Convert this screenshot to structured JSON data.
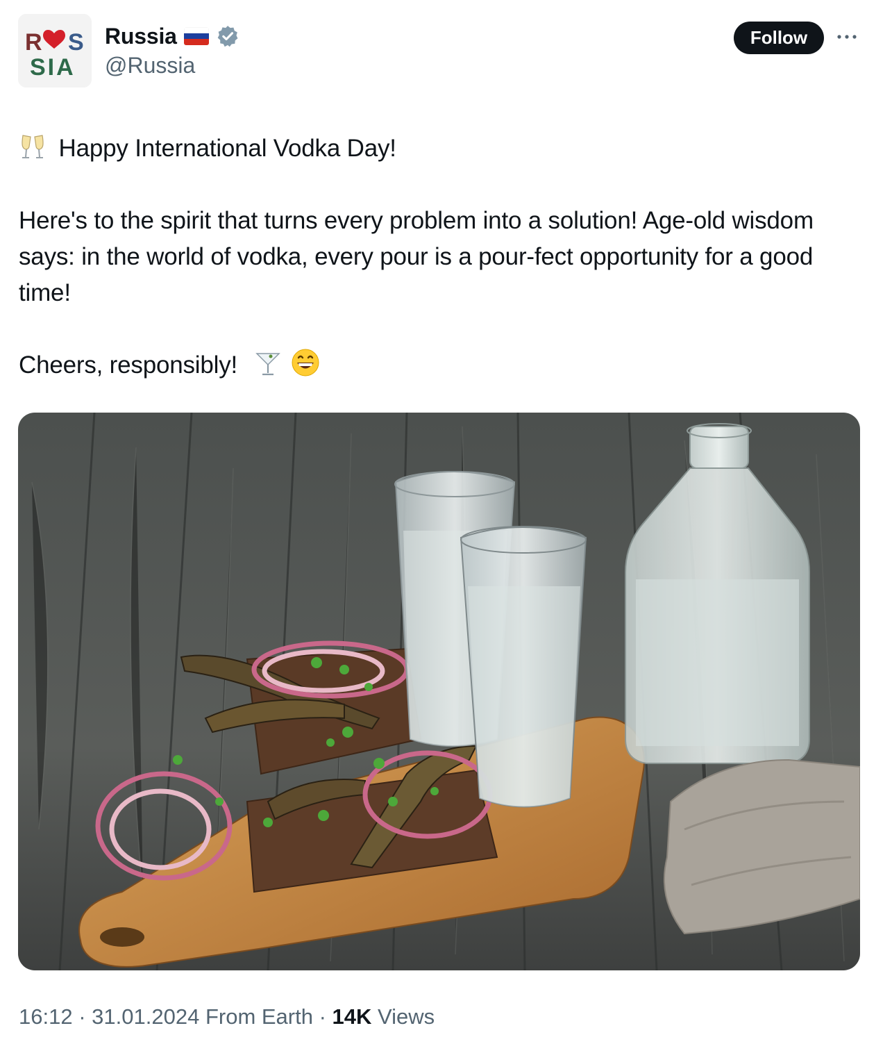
{
  "account": {
    "display_name": "Russia",
    "handle": "@Russia",
    "avatar_text": {
      "line1_left": "R",
      "line1_right": "S",
      "line2": "SIA"
    },
    "flag_icon": "russia-flag-icon",
    "verified_icon": "verified-badge-icon",
    "verified_color": "#829aab"
  },
  "actions": {
    "follow_label": "Follow",
    "more_icon": "more-options-icon"
  },
  "tweet": {
    "line1": "Happy International Vodka Day!",
    "line1_icon": "clinking-glasses-icon",
    "paragraph2": "Here's to the spirit that turns every problem into a solution! Age-old wisdom says: in the world of vodka, every pour is a pour-fect opportunity for a good time!",
    "line3": "Cheers, responsibly!",
    "line3_icons": [
      "cocktail-glass-icon",
      "grinning-face-icon"
    ]
  },
  "media": {
    "description_icon": "photo"
  },
  "meta": {
    "time": "16:12",
    "separator": "·",
    "date": "31.01.2024",
    "source": "From Earth",
    "views_count": "14K",
    "views_label": "Views"
  },
  "colors": {
    "text": "#0f1419",
    "secondary": "#536471",
    "button_bg": "#0f1419"
  }
}
